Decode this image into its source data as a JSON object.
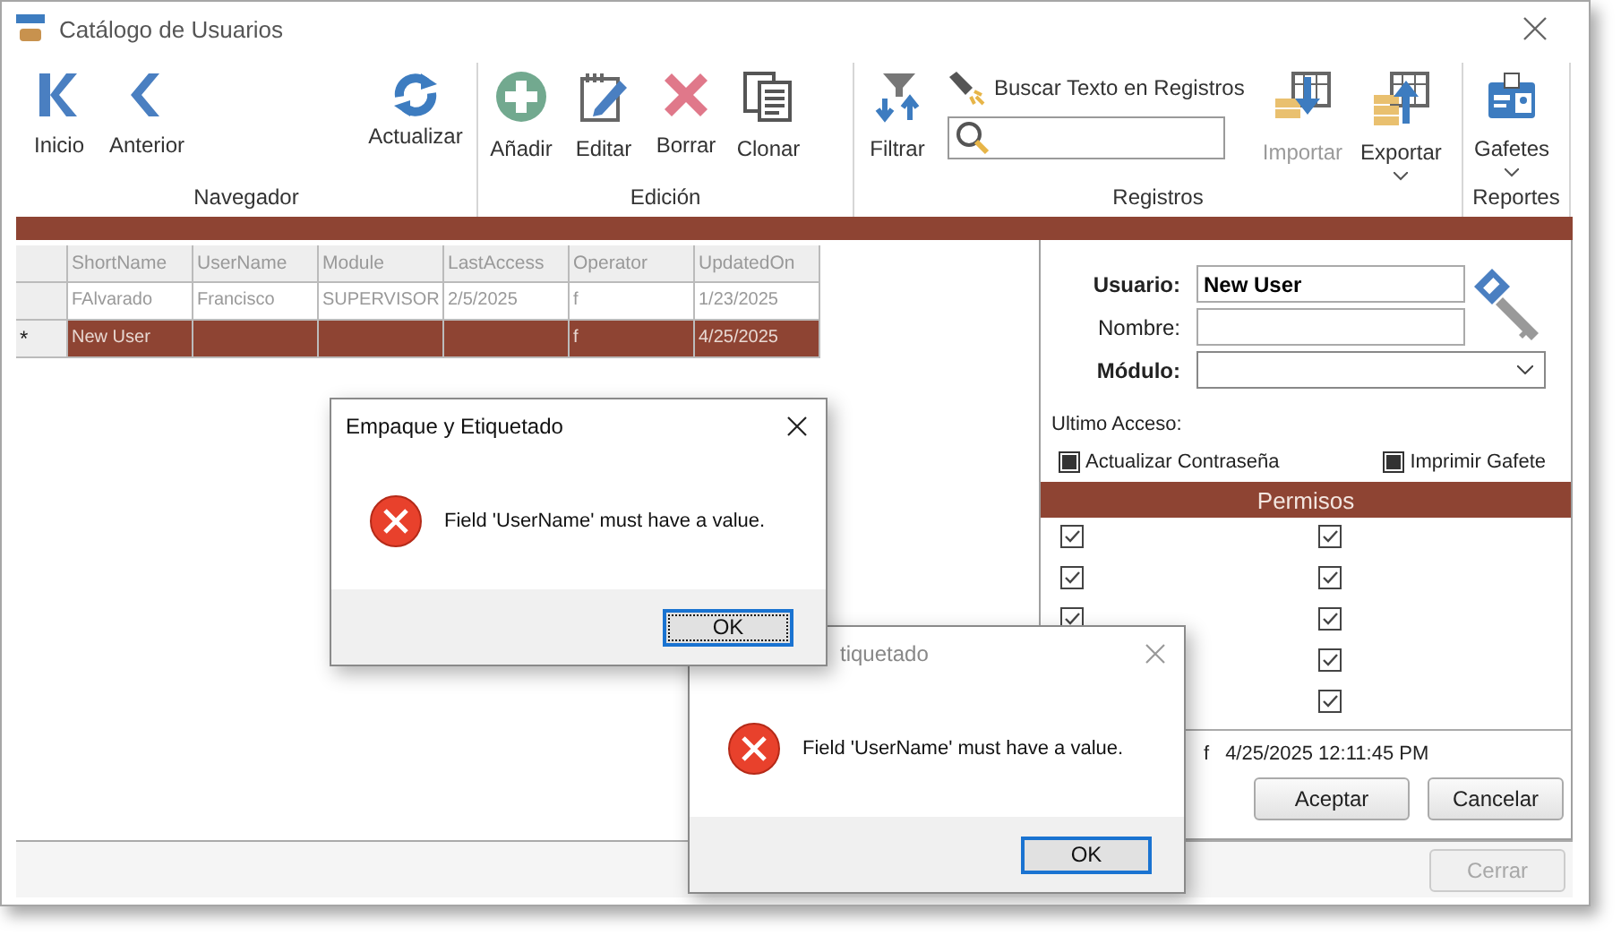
{
  "window": {
    "title": "Catálogo de Usuarios"
  },
  "ribbon": {
    "groups": [
      {
        "label": "Navegador",
        "buttons": [
          {
            "kind": "first",
            "label": "Inicio",
            "disabled": false,
            "has_menu": false
          },
          {
            "kind": "prev",
            "label": "Anterior",
            "disabled": false,
            "has_menu": false
          },
          {
            "kind": "refresh",
            "label": "Actualizar",
            "disabled": false,
            "has_menu": false
          }
        ]
      },
      {
        "label": "Edición",
        "buttons": [
          {
            "kind": "add",
            "label": "Añadir",
            "disabled": false,
            "has_menu": false
          },
          {
            "kind": "edit",
            "label": "Editar",
            "disabled": false,
            "has_menu": false
          },
          {
            "kind": "delete",
            "label": "Borrar",
            "disabled": false,
            "has_menu": false
          },
          {
            "kind": "clone",
            "label": "Clonar",
            "disabled": false,
            "has_menu": false
          }
        ]
      },
      {
        "label": "Registros",
        "buttons": [
          {
            "kind": "filter",
            "label": "Filtrar",
            "disabled": false,
            "has_menu": false
          },
          {
            "kind": "search",
            "label": "Buscar Texto en Registros",
            "disabled": false,
            "has_menu": false
          },
          {
            "kind": "import",
            "label": "Importar",
            "disabled": true,
            "has_menu": false
          },
          {
            "kind": "export",
            "label": "Exportar",
            "disabled": false,
            "has_menu": true
          }
        ]
      },
      {
        "label": "Reportes",
        "buttons": [
          {
            "kind": "badge",
            "label": "Gafetes",
            "disabled": false,
            "has_menu": true
          }
        ]
      }
    ]
  },
  "table": {
    "columns": [
      "ShortName",
      "UserName",
      "Module",
      "LastAccess",
      "Operator",
      "UpdatedOn"
    ],
    "rows": [
      {
        "marker": "",
        "selected": false,
        "cells": [
          "FAlvarado",
          "Francisco",
          "SUPERVISOR",
          "2/5/2025",
          "f",
          "1/23/2025"
        ]
      },
      {
        "marker": "*",
        "selected": true,
        "cells": [
          "New User",
          "",
          "",
          "",
          "f",
          "4/25/2025"
        ]
      }
    ]
  },
  "form": {
    "fields": [
      {
        "kind": "text",
        "label": "Usuario:",
        "required": true,
        "value": "New User"
      },
      {
        "kind": "text",
        "label": "Nombre:",
        "required": false
      },
      {
        "kind": "select",
        "label": "Módulo:",
        "required": true
      }
    ],
    "last_access_label": "Ultimo Acceso:",
    "options": [
      {
        "label": "Actualizar Contraseña",
        "indeterminate": true
      },
      {
        "label": "Imprimir Gafete",
        "indeterminate": true
      }
    ],
    "permissions_title": "Permisos",
    "permissions": [
      [
        {
          "checked": true
        },
        {
          "checked": true
        },
        {
          "checked": true
        }
      ],
      [
        {
          "checked": true
        },
        {
          "checked": true
        },
        {
          "checked": true
        },
        {
          "checked": true
        },
        {
          "checked": true
        }
      ]
    ],
    "operator": "f",
    "timestamp": "4/25/2025 12:11:45 PM",
    "buttons": [
      {
        "label": "Aceptar"
      },
      {
        "label": "Cancelar"
      }
    ]
  },
  "footer": {
    "close_button": {
      "label": "Cerrar",
      "disabled": true
    }
  },
  "dialogs": [
    {
      "title": "tiquetado",
      "message": "Field 'UserName' must have a value.",
      "button": "OK",
      "focused": false,
      "title_cut": true
    },
    {
      "title": "Empaque y Etiquetado",
      "message": "Field 'UserName' must have a value.",
      "button": "OK",
      "focused": true,
      "title_cut": false
    }
  ]
}
